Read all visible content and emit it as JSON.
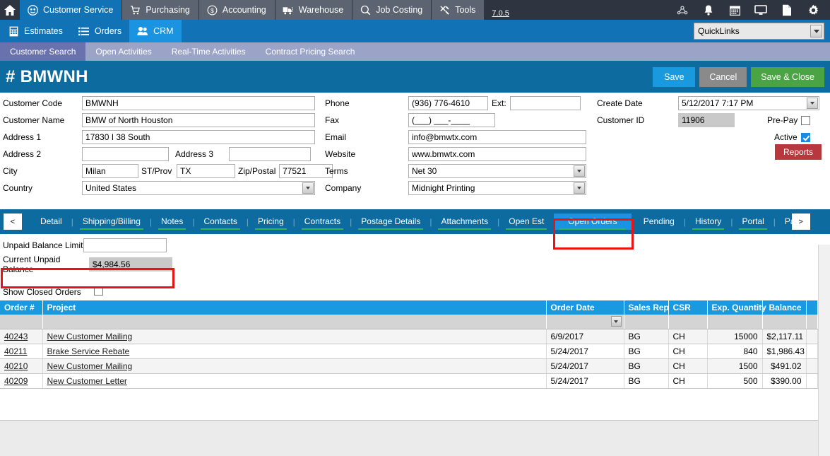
{
  "topbar": {
    "home_label": "Home",
    "modules": [
      {
        "label": "Customer Service",
        "icon": "headset-icon",
        "active": true
      },
      {
        "label": "Purchasing",
        "icon": "cart-icon",
        "active": false
      },
      {
        "label": "Accounting",
        "icon": "dollar-icon",
        "active": false
      },
      {
        "label": "Warehouse",
        "icon": "truck-icon",
        "active": false
      },
      {
        "label": "Job Costing",
        "icon": "magnifier-icon",
        "active": false
      },
      {
        "label": "Tools",
        "icon": "tools-icon",
        "active": false
      }
    ],
    "version": "7.0.5",
    "icons": [
      "network-icon",
      "bell-icon",
      "calendar-icon",
      "monitor-icon",
      "document-icon",
      "gear-icon"
    ]
  },
  "subbar": {
    "items": [
      {
        "label": "Estimates",
        "icon": "calculator-icon",
        "active": false
      },
      {
        "label": "Orders",
        "icon": "list-icon",
        "active": false
      },
      {
        "label": "CRM",
        "icon": "people-icon",
        "active": true
      }
    ],
    "quicklinks_label": "QuickLinks"
  },
  "pagebar": {
    "tabs": [
      {
        "label": "Customer Search",
        "active": true
      },
      {
        "label": "Open Activities",
        "active": false
      },
      {
        "label": "Real-Time Activities",
        "active": false
      },
      {
        "label": "Contract Pricing Search",
        "active": false
      }
    ]
  },
  "title": {
    "text": "# BMWNH",
    "save_label": "Save",
    "cancel_label": "Cancel",
    "save_close_label": "Save & Close"
  },
  "form": {
    "customer_code_label": "Customer Code",
    "customer_code_value": "BMWNH",
    "customer_name_label": "Customer Name",
    "customer_name_value": "BMW of North Houston",
    "address1_label": "Address 1",
    "address1_value": "17830 I 38 South",
    "address2_label": "Address 2",
    "address2_value": "",
    "address3_label": "Address 3",
    "address3_value": "",
    "city_label": "City",
    "city_value": "Milan",
    "state_label": "ST/Prov",
    "state_value": "TX",
    "zip_label": "Zip/Postal",
    "zip_value": "77521",
    "country_label": "Country",
    "country_value": "United States",
    "phone_label": "Phone",
    "phone_value": "(936) 776-4610",
    "ext_label": "Ext:",
    "ext_value": "",
    "fax_label": "Fax",
    "fax_value": "(___) ___-____",
    "email_label": "Email",
    "email_value": "info@bmwtx.com",
    "website_label": "Website",
    "website_value": "www.bmwtx.com",
    "terms_label": "Terms",
    "terms_value": "Net 30",
    "company_label": "Company",
    "company_value": "Midnight Printing",
    "create_date_label": "Create Date",
    "create_date_value": "5/12/2017 7:17 PM",
    "customer_id_label": "Customer ID",
    "customer_id_value": "11906",
    "prepay_label": "Pre-Pay",
    "prepay_checked": false,
    "active_label": "Active",
    "active_checked": true,
    "reports_label": "Reports"
  },
  "detail_tabs": {
    "prev_label": "<",
    "next_label": ">",
    "items": [
      {
        "label": "Detail",
        "active": false,
        "underline": false
      },
      {
        "label": "Shipping/Billing",
        "active": false,
        "underline": true
      },
      {
        "label": "Notes",
        "active": false,
        "underline": true
      },
      {
        "label": "Contacts",
        "active": false,
        "underline": true
      },
      {
        "label": "Pricing",
        "active": false,
        "underline": true
      },
      {
        "label": "Contracts",
        "active": false,
        "underline": true
      },
      {
        "label": "Postage Details",
        "active": false,
        "underline": true
      },
      {
        "label": "Attachments",
        "active": false,
        "underline": true
      },
      {
        "label": "Open Est",
        "active": false,
        "underline": true
      },
      {
        "label": "Open Orders",
        "active": true,
        "underline": true
      },
      {
        "label": "Pending",
        "active": false,
        "underline": true
      },
      {
        "label": "History",
        "active": false,
        "underline": true
      },
      {
        "label": "Portal",
        "active": false,
        "underline": true
      },
      {
        "label": "Pa",
        "active": false,
        "underline": false
      }
    ]
  },
  "balance": {
    "limit_label": "Unpaid Balance Limit",
    "limit_value": "",
    "current_label": "Current Unpaid Balance",
    "current_value": "$4,984.56"
  },
  "orders": {
    "show_closed_label": "Show Closed Orders",
    "show_closed_checked": false,
    "columns": [
      {
        "key": "order",
        "label": "Order #",
        "align": "left"
      },
      {
        "key": "project",
        "label": "Project",
        "align": "left"
      },
      {
        "key": "order_date",
        "label": "Order Date",
        "align": "left"
      },
      {
        "key": "sales_rep",
        "label": "Sales Rep",
        "align": "left"
      },
      {
        "key": "csr",
        "label": "CSR",
        "align": "left"
      },
      {
        "key": "exp_quantity",
        "label": "Exp. Quantity",
        "align": "right"
      },
      {
        "key": "balance",
        "label": "Balance",
        "align": "right"
      },
      {
        "key": "spacer",
        "label": "",
        "align": "left"
      }
    ],
    "rows": [
      {
        "order": "40243",
        "project": "New Customer Mailing",
        "order_date": "6/9/2017",
        "sales_rep": "BG",
        "csr": "CH",
        "exp_quantity": "15000",
        "balance": "$2,117.11"
      },
      {
        "order": "40211",
        "project": "Brake Service Rebate",
        "order_date": "5/24/2017",
        "sales_rep": "BG",
        "csr": "CH",
        "exp_quantity": "840",
        "balance": "$1,986.43"
      },
      {
        "order": "40210",
        "project": "New Customer Mailing",
        "order_date": "5/24/2017",
        "sales_rep": "BG",
        "csr": "CH",
        "exp_quantity": "1500",
        "balance": "$491.02"
      },
      {
        "order": "40209",
        "project": "New Customer Letter",
        "order_date": "5/24/2017",
        "sales_rep": "BG",
        "csr": "CH",
        "exp_quantity": "500",
        "balance": "$390.00"
      }
    ]
  },
  "colors": {
    "topbar_bg": "#2e3440",
    "module_active": "#1173b6",
    "subbar_bg": "#1173b6",
    "pagebar_bg": "#9ba4c7",
    "pagebar_active": "#6a72ad",
    "title_bg": "#0e6ba0",
    "tab_active": "#1a93e0",
    "grid_header": "#1a9ade",
    "annotation": "#e81313",
    "save": "#1a9ade",
    "cancel": "#8a8a8a",
    "save_close": "#4aa444",
    "reports": "#b8383e"
  }
}
